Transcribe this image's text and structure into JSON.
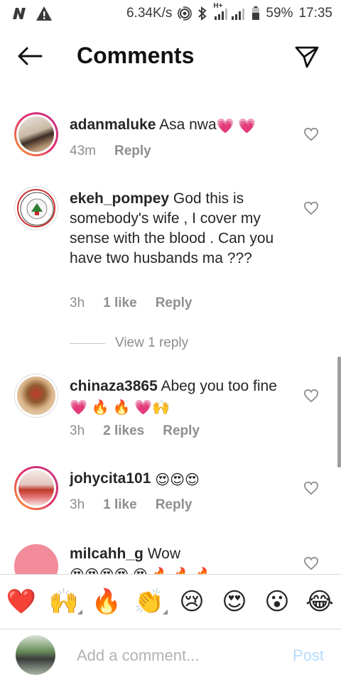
{
  "status_bar": {
    "speed": "6.34K/s",
    "battery": "59%",
    "time": "17:35",
    "network": "H+"
  },
  "header": {
    "title": "Comments"
  },
  "comments": [
    {
      "username": "adanmaluke",
      "text": "Asa nwa",
      "emojis": "💗 💗",
      "time": "43m",
      "likes": "",
      "reply": "Reply"
    },
    {
      "username": "ekeh_pompey",
      "text": "God this is somebody's wife , I cover my sense with the blood . Can you have two husbands ma ???",
      "emojis": "",
      "time": "3h",
      "likes": "1 like",
      "reply": "Reply",
      "view_replies": "View 1 reply"
    },
    {
      "username": "chinaza3865",
      "text": "Abeg you too fine",
      "emojis": "💗 🔥 🔥 💗🙌",
      "time": "3h",
      "likes": "2 likes",
      "reply": "Reply"
    },
    {
      "username": "johycita101",
      "text": "",
      "emojis": "😍😍😍",
      "time": "3h",
      "likes": "1 like",
      "reply": "Reply"
    },
    {
      "username": "milcahh_g",
      "text": "Wow",
      "emojis": "😍😍😍😍 😍 🔥 🔥 🔥",
      "time": "",
      "likes": "",
      "reply": ""
    }
  ],
  "emoji_bar": [
    "❤️",
    "🙌",
    "🔥",
    "👏",
    "😢",
    "😍",
    "😮",
    "😂"
  ],
  "composer": {
    "placeholder": "Add a comment...",
    "post_label": "Post"
  },
  "colors": {
    "accent_ring_start": "#f9a12e",
    "accent_ring_end": "#c13584",
    "post_disabled": "#b6dafc",
    "muted": "#8e8e8e"
  }
}
